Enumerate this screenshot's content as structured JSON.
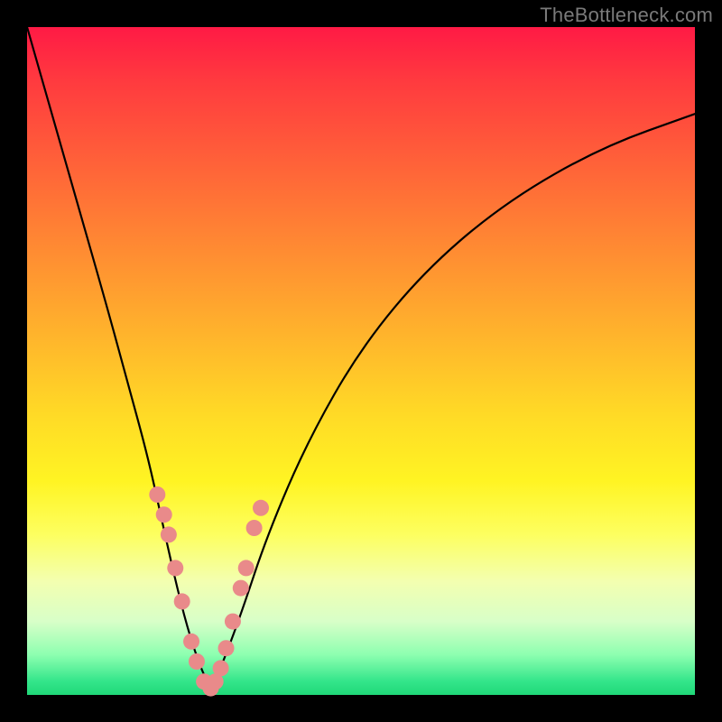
{
  "watermark": "TheBottleneck.com",
  "colors": {
    "frame": "#000000",
    "curve": "#000000",
    "marker": "#e98a8a",
    "gradient_top": "#ff1a45",
    "gradient_bottom": "#20d878"
  },
  "chart_data": {
    "type": "line",
    "title": "",
    "xlabel": "",
    "ylabel": "",
    "xlim": [
      0,
      100
    ],
    "ylim": [
      0,
      100
    ],
    "grid": false,
    "legend": "none",
    "annotations": [
      "TheBottleneck.com"
    ],
    "series": [
      {
        "name": "bottleneck-curve",
        "x": [
          0,
          4,
          8,
          12,
          15,
          18,
          20,
          22,
          24,
          26,
          27.5,
          29,
          32,
          36,
          42,
          50,
          60,
          72,
          86,
          100
        ],
        "y": [
          100,
          86,
          72,
          58,
          47,
          36,
          27,
          18,
          10,
          4,
          1,
          4,
          12,
          24,
          38,
          52,
          64,
          74,
          82,
          87
        ]
      }
    ],
    "markers": {
      "name": "highlighted-points",
      "x": [
        19.5,
        20.5,
        21.2,
        22.2,
        23.2,
        24.6,
        25.4,
        26.5,
        27.5,
        28.2,
        29.0,
        29.8,
        30.8,
        32.0,
        32.8,
        34.0,
        35.0
      ],
      "y": [
        30,
        27,
        24,
        19,
        14,
        8,
        5,
        2,
        1,
        2,
        4,
        7,
        11,
        16,
        19,
        25,
        28
      ]
    }
  }
}
